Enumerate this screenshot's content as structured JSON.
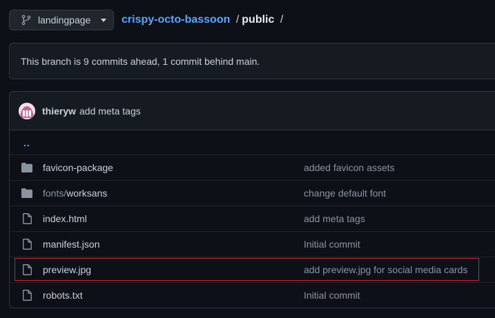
{
  "branch": {
    "name": "landingpage"
  },
  "breadcrumb": {
    "repo": "crispy-octo-bassoon",
    "sep1": "/",
    "folder": "public",
    "sep2": "/"
  },
  "notice": {
    "text": "This branch is 9 commits ahead, 1 commit behind main."
  },
  "latest_commit": {
    "author": "thieryw",
    "message": "add meta tags"
  },
  "up_dir": "..",
  "files": [
    {
      "type": "folder",
      "name_prefix": "",
      "name": "favicon-package",
      "commit": "added favicon assets"
    },
    {
      "type": "folder",
      "name_prefix": "fonts/",
      "name": "worksans",
      "commit": "change default font"
    },
    {
      "type": "file",
      "name_prefix": "",
      "name": "index.html",
      "commit": "add meta tags"
    },
    {
      "type": "file",
      "name_prefix": "",
      "name": "manifest.json",
      "commit": "Initial commit"
    },
    {
      "type": "file",
      "name_prefix": "",
      "name": "preview.jpg",
      "commit": "add preview.jpg for social media cards",
      "highlighted": true
    },
    {
      "type": "file",
      "name_prefix": "",
      "name": "robots.txt",
      "commit": "Initial commit"
    }
  ],
  "colors": {
    "link": "#58a6ff",
    "highlight": "#d1242f",
    "bg": "#0d1117"
  }
}
